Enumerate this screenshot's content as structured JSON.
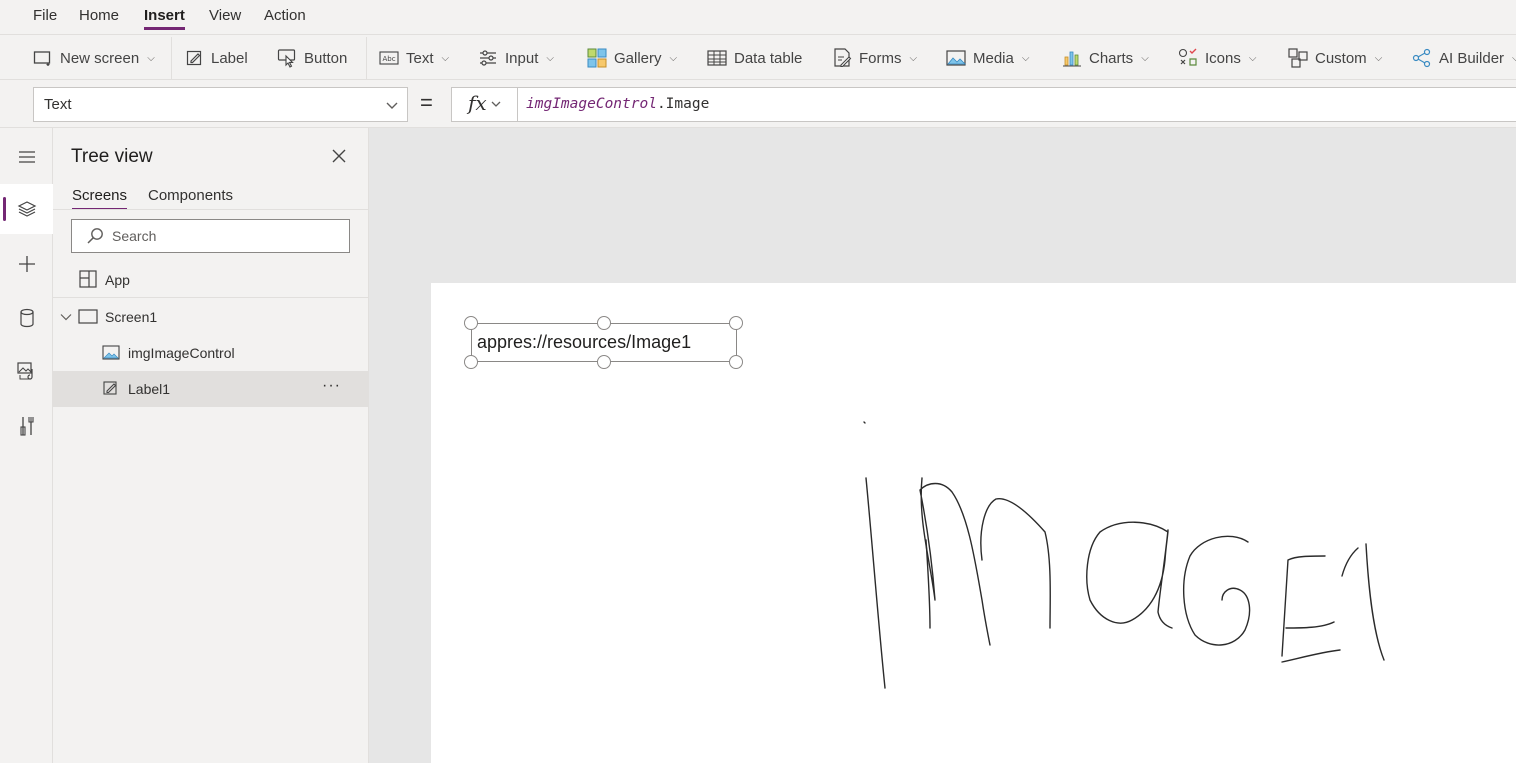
{
  "menu": {
    "items": [
      {
        "label": "File"
      },
      {
        "label": "Home"
      },
      {
        "label": "Insert",
        "active": true
      },
      {
        "label": "View"
      },
      {
        "label": "Action"
      }
    ]
  },
  "ribbon": {
    "new_screen": "New screen",
    "label": "Label",
    "button": "Button",
    "text": "Text",
    "input": "Input",
    "gallery": "Gallery",
    "data_table": "Data table",
    "forms": "Forms",
    "media": "Media",
    "charts": "Charts",
    "icons": "Icons",
    "custom": "Custom",
    "ai_builder": "AI Builder"
  },
  "formula_bar": {
    "property": "Text",
    "equals": "=",
    "fx": "fx",
    "formula_control": "imgImageControl",
    "formula_property": ".Image"
  },
  "tree_view": {
    "title": "Tree view",
    "tabs": [
      {
        "label": "Screens",
        "active": true
      },
      {
        "label": "Components",
        "active": false
      }
    ],
    "search_placeholder": "Search",
    "app": "App",
    "screen": "Screen1",
    "children": [
      {
        "label": "imgImageControl",
        "icon": "image-icon",
        "selected": false
      },
      {
        "label": "Label1",
        "icon": "label-edit-icon",
        "selected": true
      }
    ],
    "more": "···"
  },
  "canvas": {
    "label1_text": "appres://resources/Image1"
  },
  "colors": {
    "accent": "#742774",
    "chrome": "#f3f2f1",
    "canvas_bg": "#e6e6e6"
  }
}
